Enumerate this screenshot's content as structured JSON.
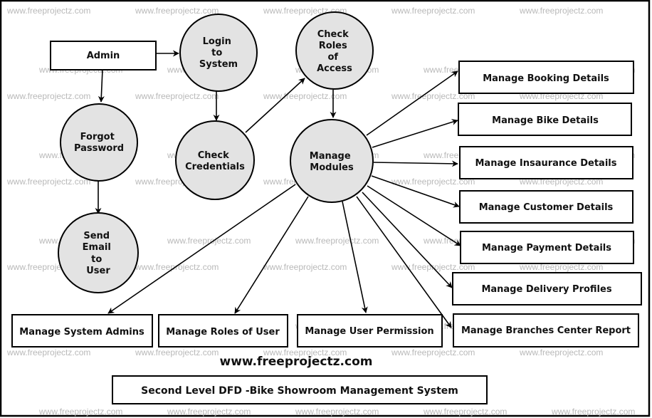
{
  "watermark": "www.freeprojectz.com",
  "site_label": "www.freeprojectz.com",
  "title": "Second Level DFD -Bike Showroom Management System",
  "entities": {
    "admin": "Admin"
  },
  "processes": {
    "login": [
      "Login",
      "to",
      "System"
    ],
    "check_roles": [
      "Check",
      "Roles",
      "of",
      "Access"
    ],
    "forgot_password": [
      "Forgot",
      "Password"
    ],
    "check_credentials": [
      "Check",
      "Credentials"
    ],
    "manage_modules": [
      "Manage",
      "Modules"
    ],
    "send_email": [
      "Send",
      "Email",
      "to",
      "User"
    ]
  },
  "modules": {
    "booking": "Manage Booking Details",
    "bike": "Manage Bike Details",
    "insurance": "Manage Insaurance Details",
    "customer": "Manage Customer Details",
    "payment": "Manage Payment Details",
    "delivery": "Manage Delivery Profiles",
    "branches": "Manage Branches Center Report",
    "system_admins": "Manage System Admins",
    "roles": "Manage Roles of User",
    "permission": "Manage User Permission"
  },
  "flows": [
    {
      "from": "Admin",
      "to": "Login to System"
    },
    {
      "from": "Admin",
      "to": "Forgot Password"
    },
    {
      "from": "Forgot Password",
      "to": "Send Email to User"
    },
    {
      "from": "Login to System",
      "to": "Check Credentials"
    },
    {
      "from": "Check Credentials",
      "to": "Check Roles of Access"
    },
    {
      "from": "Check Roles of Access",
      "to": "Manage Modules"
    },
    {
      "from": "Manage Modules",
      "to": "Manage Booking Details"
    },
    {
      "from": "Manage Modules",
      "to": "Manage Bike Details"
    },
    {
      "from": "Manage Modules",
      "to": "Manage Insaurance Details"
    },
    {
      "from": "Manage Modules",
      "to": "Manage Customer Details"
    },
    {
      "from": "Manage Modules",
      "to": "Manage Payment Details"
    },
    {
      "from": "Manage Modules",
      "to": "Manage Delivery Profiles"
    },
    {
      "from": "Manage Modules",
      "to": "Manage Branches Center Report"
    },
    {
      "from": "Manage Modules",
      "to": "Manage User Permission"
    },
    {
      "from": "Manage Modules",
      "to": "Manage Roles of User"
    },
    {
      "from": "Manage Modules",
      "to": "Manage System Admins"
    }
  ]
}
